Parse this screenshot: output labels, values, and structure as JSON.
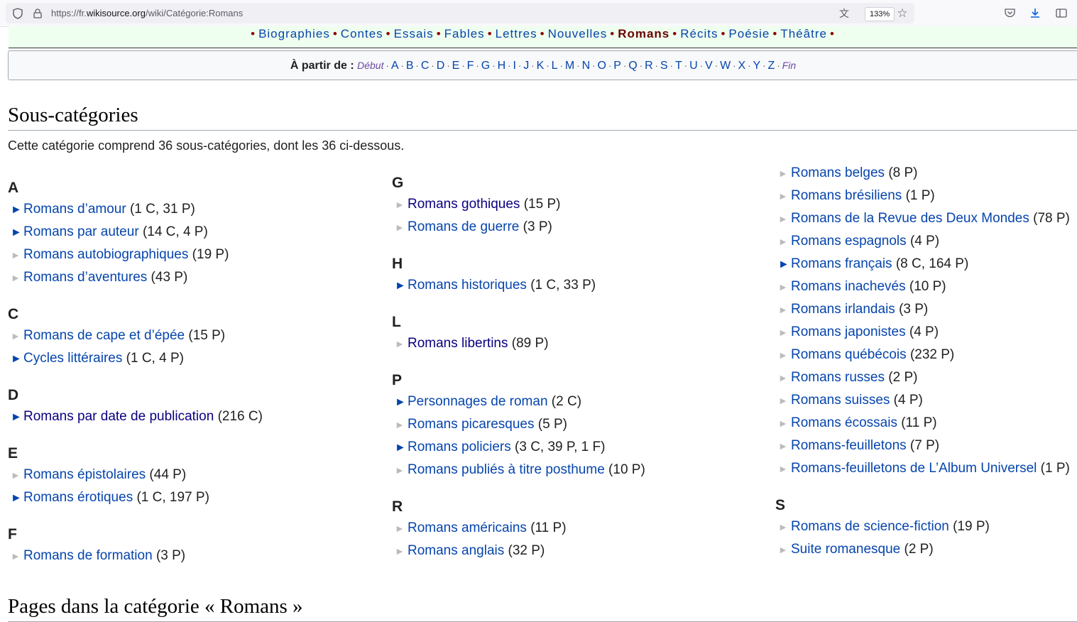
{
  "browser": {
    "url_prefix": "https://fr.",
    "url_host": "wikisource.org",
    "url_path": "/wiki/Catégorie:Romans",
    "zoom": "133%"
  },
  "genres": [
    "Biographies",
    "Contes",
    "Essais",
    "Fables",
    "Lettres",
    "Nouvelles",
    "Romans",
    "Récits",
    "Poésie",
    "Théâtre"
  ],
  "alpha": {
    "label": "À partir de :",
    "start": "Début",
    "end": "Fin",
    "letters": [
      "A",
      "B",
      "C",
      "D",
      "E",
      "F",
      "G",
      "H",
      "I",
      "J",
      "K",
      "L",
      "M",
      "N",
      "O",
      "P",
      "Q",
      "R",
      "S",
      "T",
      "U",
      "V",
      "W",
      "X",
      "Y",
      "Z"
    ]
  },
  "subcats": {
    "heading": "Sous-catégories",
    "intro": "Cette catégorie comprend 36 sous-catégories, dont les 36 ci-dessous.",
    "columns": [
      [
        {
          "letter": "A",
          "items": [
            {
              "name": "Romans d’amour",
              "count": "(1 C, 31 P)",
              "exp": true
            },
            {
              "name": "Romans par auteur",
              "count": "(14 C, 4 P)",
              "exp": true
            },
            {
              "name": "Romans autobiographiques",
              "count": "(19 P)",
              "exp": false
            },
            {
              "name": "Romans d’aventures",
              "count": "(43 P)",
              "exp": false
            }
          ]
        },
        {
          "letter": "C",
          "items": [
            {
              "name": "Romans de cape et d’épée",
              "count": "(15 P)",
              "exp": false
            },
            {
              "name": "Cycles littéraires",
              "count": "(1 C, 4 P)",
              "exp": true
            }
          ]
        },
        {
          "letter": "D",
          "items": [
            {
              "name": "Romans par date de publication",
              "count": "(216 C)",
              "exp": true,
              "visited": true
            }
          ]
        },
        {
          "letter": "E",
          "items": [
            {
              "name": "Romans épistolaires",
              "count": "(44 P)",
              "exp": false
            },
            {
              "name": "Romans érotiques",
              "count": "(1 C, 197 P)",
              "exp": true
            }
          ]
        },
        {
          "letter": "F",
          "items": [
            {
              "name": "Romans de formation",
              "count": "(3 P)",
              "exp": false
            }
          ]
        }
      ],
      [
        {
          "letter": "G",
          "items": [
            {
              "name": "Romans gothiques",
              "count": "(15 P)",
              "exp": false,
              "visited": true
            },
            {
              "name": "Romans de guerre",
              "count": "(3 P)",
              "exp": false
            }
          ]
        },
        {
          "letter": "H",
          "items": [
            {
              "name": "Romans historiques",
              "count": "(1 C, 33 P)",
              "exp": true
            }
          ]
        },
        {
          "letter": "L",
          "items": [
            {
              "name": "Romans libertins",
              "count": "(89 P)",
              "exp": false,
              "visited": true
            }
          ]
        },
        {
          "letter": "P",
          "items": [
            {
              "name": "Personnages de roman",
              "count": "(2 C)",
              "exp": true
            },
            {
              "name": "Romans picaresques",
              "count": "(5 P)",
              "exp": false
            },
            {
              "name": "Romans policiers",
              "count": "(3 C, 39 P, 1 F)",
              "exp": true
            },
            {
              "name": "Romans publiés à titre posthume",
              "count": "(10 P)",
              "exp": false
            }
          ]
        },
        {
          "letter": "R",
          "items": [
            {
              "name": "Romans américains",
              "count": "(11 P)",
              "exp": false
            },
            {
              "name": "Romans anglais",
              "count": "(32 P)",
              "exp": false
            }
          ]
        }
      ],
      [
        {
          "letter": "",
          "items": [
            {
              "name": "Romans belges",
              "count": "(8 P)",
              "exp": false
            },
            {
              "name": "Romans brésiliens",
              "count": "(1 P)",
              "exp": false
            },
            {
              "name": "Romans de la Revue des Deux Mondes",
              "count": "(78 P)",
              "exp": false
            },
            {
              "name": "Romans espagnols",
              "count": "(4 P)",
              "exp": false
            },
            {
              "name": "Romans français",
              "count": "(8 C, 164 P)",
              "exp": true
            },
            {
              "name": "Romans inachevés",
              "count": "(10 P)",
              "exp": false
            },
            {
              "name": "Romans irlandais",
              "count": "(3 P)",
              "exp": false
            },
            {
              "name": "Romans japonistes",
              "count": "(4 P)",
              "exp": false
            },
            {
              "name": "Romans québécois",
              "count": "(232 P)",
              "exp": false
            },
            {
              "name": "Romans russes",
              "count": "(2 P)",
              "exp": false
            },
            {
              "name": "Romans suisses",
              "count": "(4 P)",
              "exp": false
            },
            {
              "name": "Romans écossais",
              "count": "(11 P)",
              "exp": false
            },
            {
              "name": "Romans-feuilletons",
              "count": "(7 P)",
              "exp": false
            },
            {
              "name": "Romans-feuilletons de L’Album Universel",
              "count": "(1 P)",
              "exp": false
            }
          ]
        },
        {
          "letter": "S",
          "items": [
            {
              "name": "Romans de science-fiction",
              "count": "(19 P)",
              "exp": false
            },
            {
              "name": "Suite romanesque",
              "count": "(2 P)",
              "exp": false
            }
          ]
        }
      ]
    ]
  },
  "pages": {
    "heading": "Pages dans la catégorie « Romans »"
  }
}
